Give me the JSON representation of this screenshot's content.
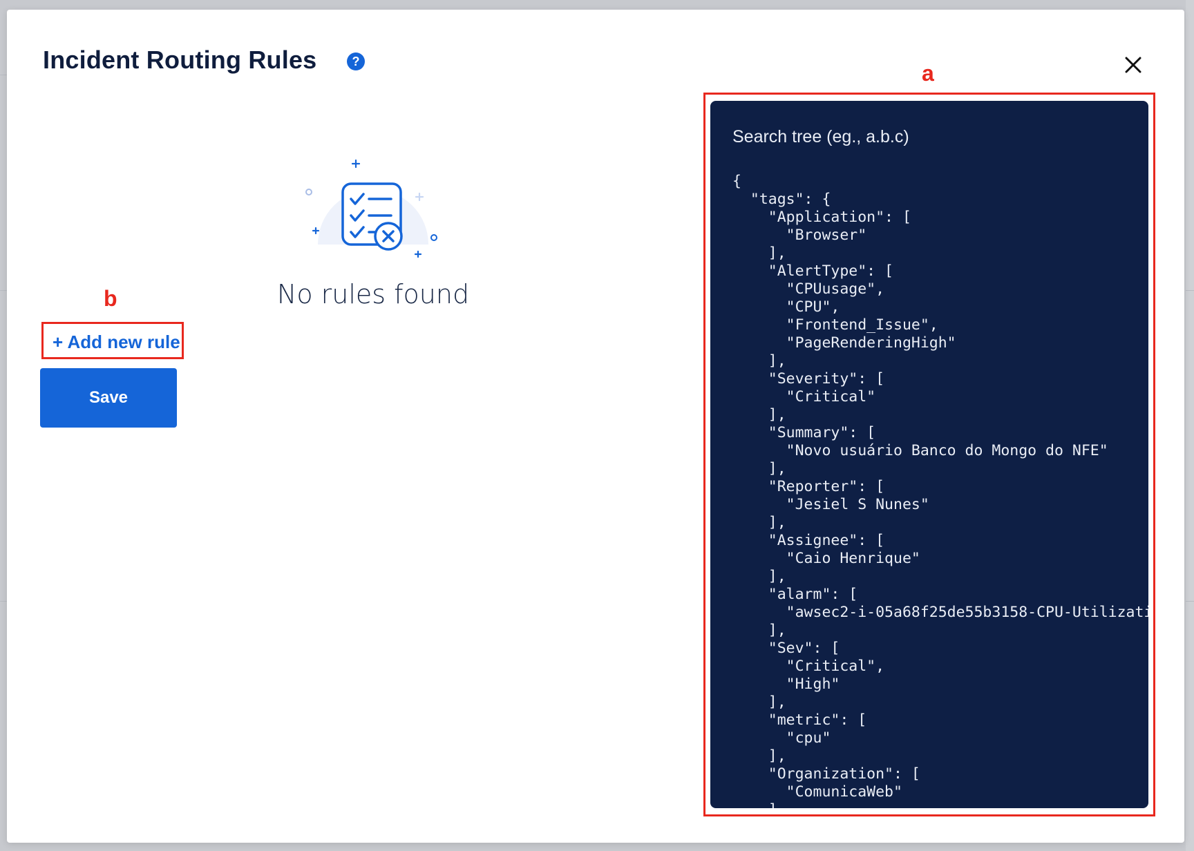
{
  "modal": {
    "title": "Incident Routing Rules",
    "help_glyph": "?",
    "close_glyph": "×"
  },
  "annotations": {
    "a": "a",
    "b": "b"
  },
  "empty_state": {
    "message": "No rules found",
    "icon": "checklist-with-x-icon"
  },
  "actions": {
    "add_rule_label": "+ Add new rule",
    "save_label": "Save"
  },
  "tree": {
    "search_placeholder": "Search tree (eg., a.b.c)",
    "lines": [
      "{",
      "  \"tags\": {",
      "    \"Application\": [",
      "      \"Browser\"",
      "    ],",
      "    \"AlertType\": [",
      "      \"CPUusage\",",
      "      \"CPU\",",
      "      \"Frontend_Issue\",",
      "      \"PageRenderingHigh\"",
      "    ],",
      "    \"Severity\": [",
      "      \"Critical\"",
      "    ],",
      "    \"Summary\": [",
      "      \"Novo usuário Banco do Mongo do NFE\"",
      "    ],",
      "    \"Reporter\": [",
      "      \"Jesiel S Nunes\"",
      "    ],",
      "    \"Assignee\": [",
      "      \"Caio Henrique\"",
      "    ],",
      "    \"alarm\": [",
      "      \"awsec2-i-05a68f25de55b3158-CPU-Utilizati",
      "    ],",
      "    \"Sev\": [",
      "      \"Critical\",",
      "      \"High\"",
      "    ],",
      "    \"metric\": [",
      "      \"cpu\"",
      "    ],",
      "    \"Organization\": [",
      "      \"ComunicaWeb\"",
      "    ],"
    ]
  },
  "colors": {
    "primary": "#1565d8",
    "panel_bg": "#0e1f45",
    "annotation": "#e8281e",
    "title": "#0f1d3d"
  }
}
